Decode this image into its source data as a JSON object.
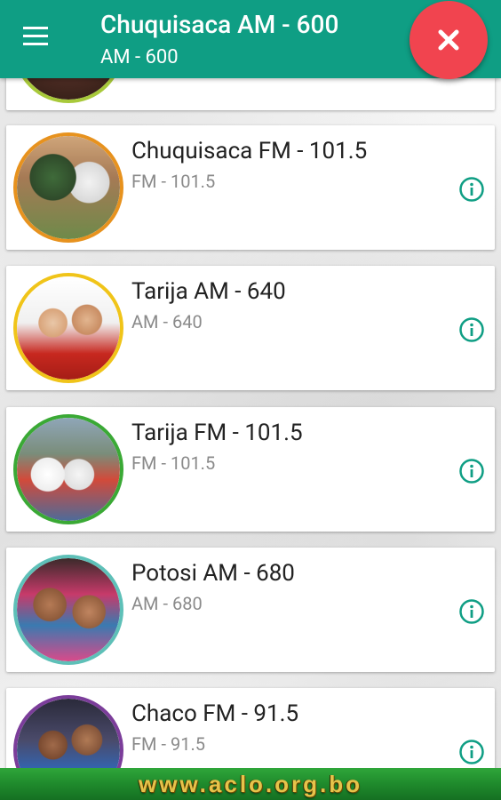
{
  "header": {
    "title": "Chuquisaca AM - 600",
    "subtitle": "AM - 600",
    "menu_icon": "hamburger-menu-icon",
    "close_icon": "close-icon",
    "accent_color": "#0f9e84",
    "fab_color": "#f1444f"
  },
  "stations": [
    {
      "name": "Chuquisaca FM - 101.5",
      "freq": "FM - 101.5",
      "ring_color": "#e7921e"
    },
    {
      "name": "Tarija AM - 640",
      "freq": "AM - 640",
      "ring_color": "#f0c419"
    },
    {
      "name": "Tarija FM - 101.5",
      "freq": "FM - 101.5",
      "ring_color": "#3aa935"
    },
    {
      "name": "Potosi AM - 680",
      "freq": "AM - 680",
      "ring_color": "#5ec0b8"
    },
    {
      "name": "Chaco FM - 91.5",
      "freq": "FM - 91.5",
      "ring_color": "#7b3d9a"
    }
  ],
  "footer": {
    "text": "www.aclo.org.bo"
  }
}
